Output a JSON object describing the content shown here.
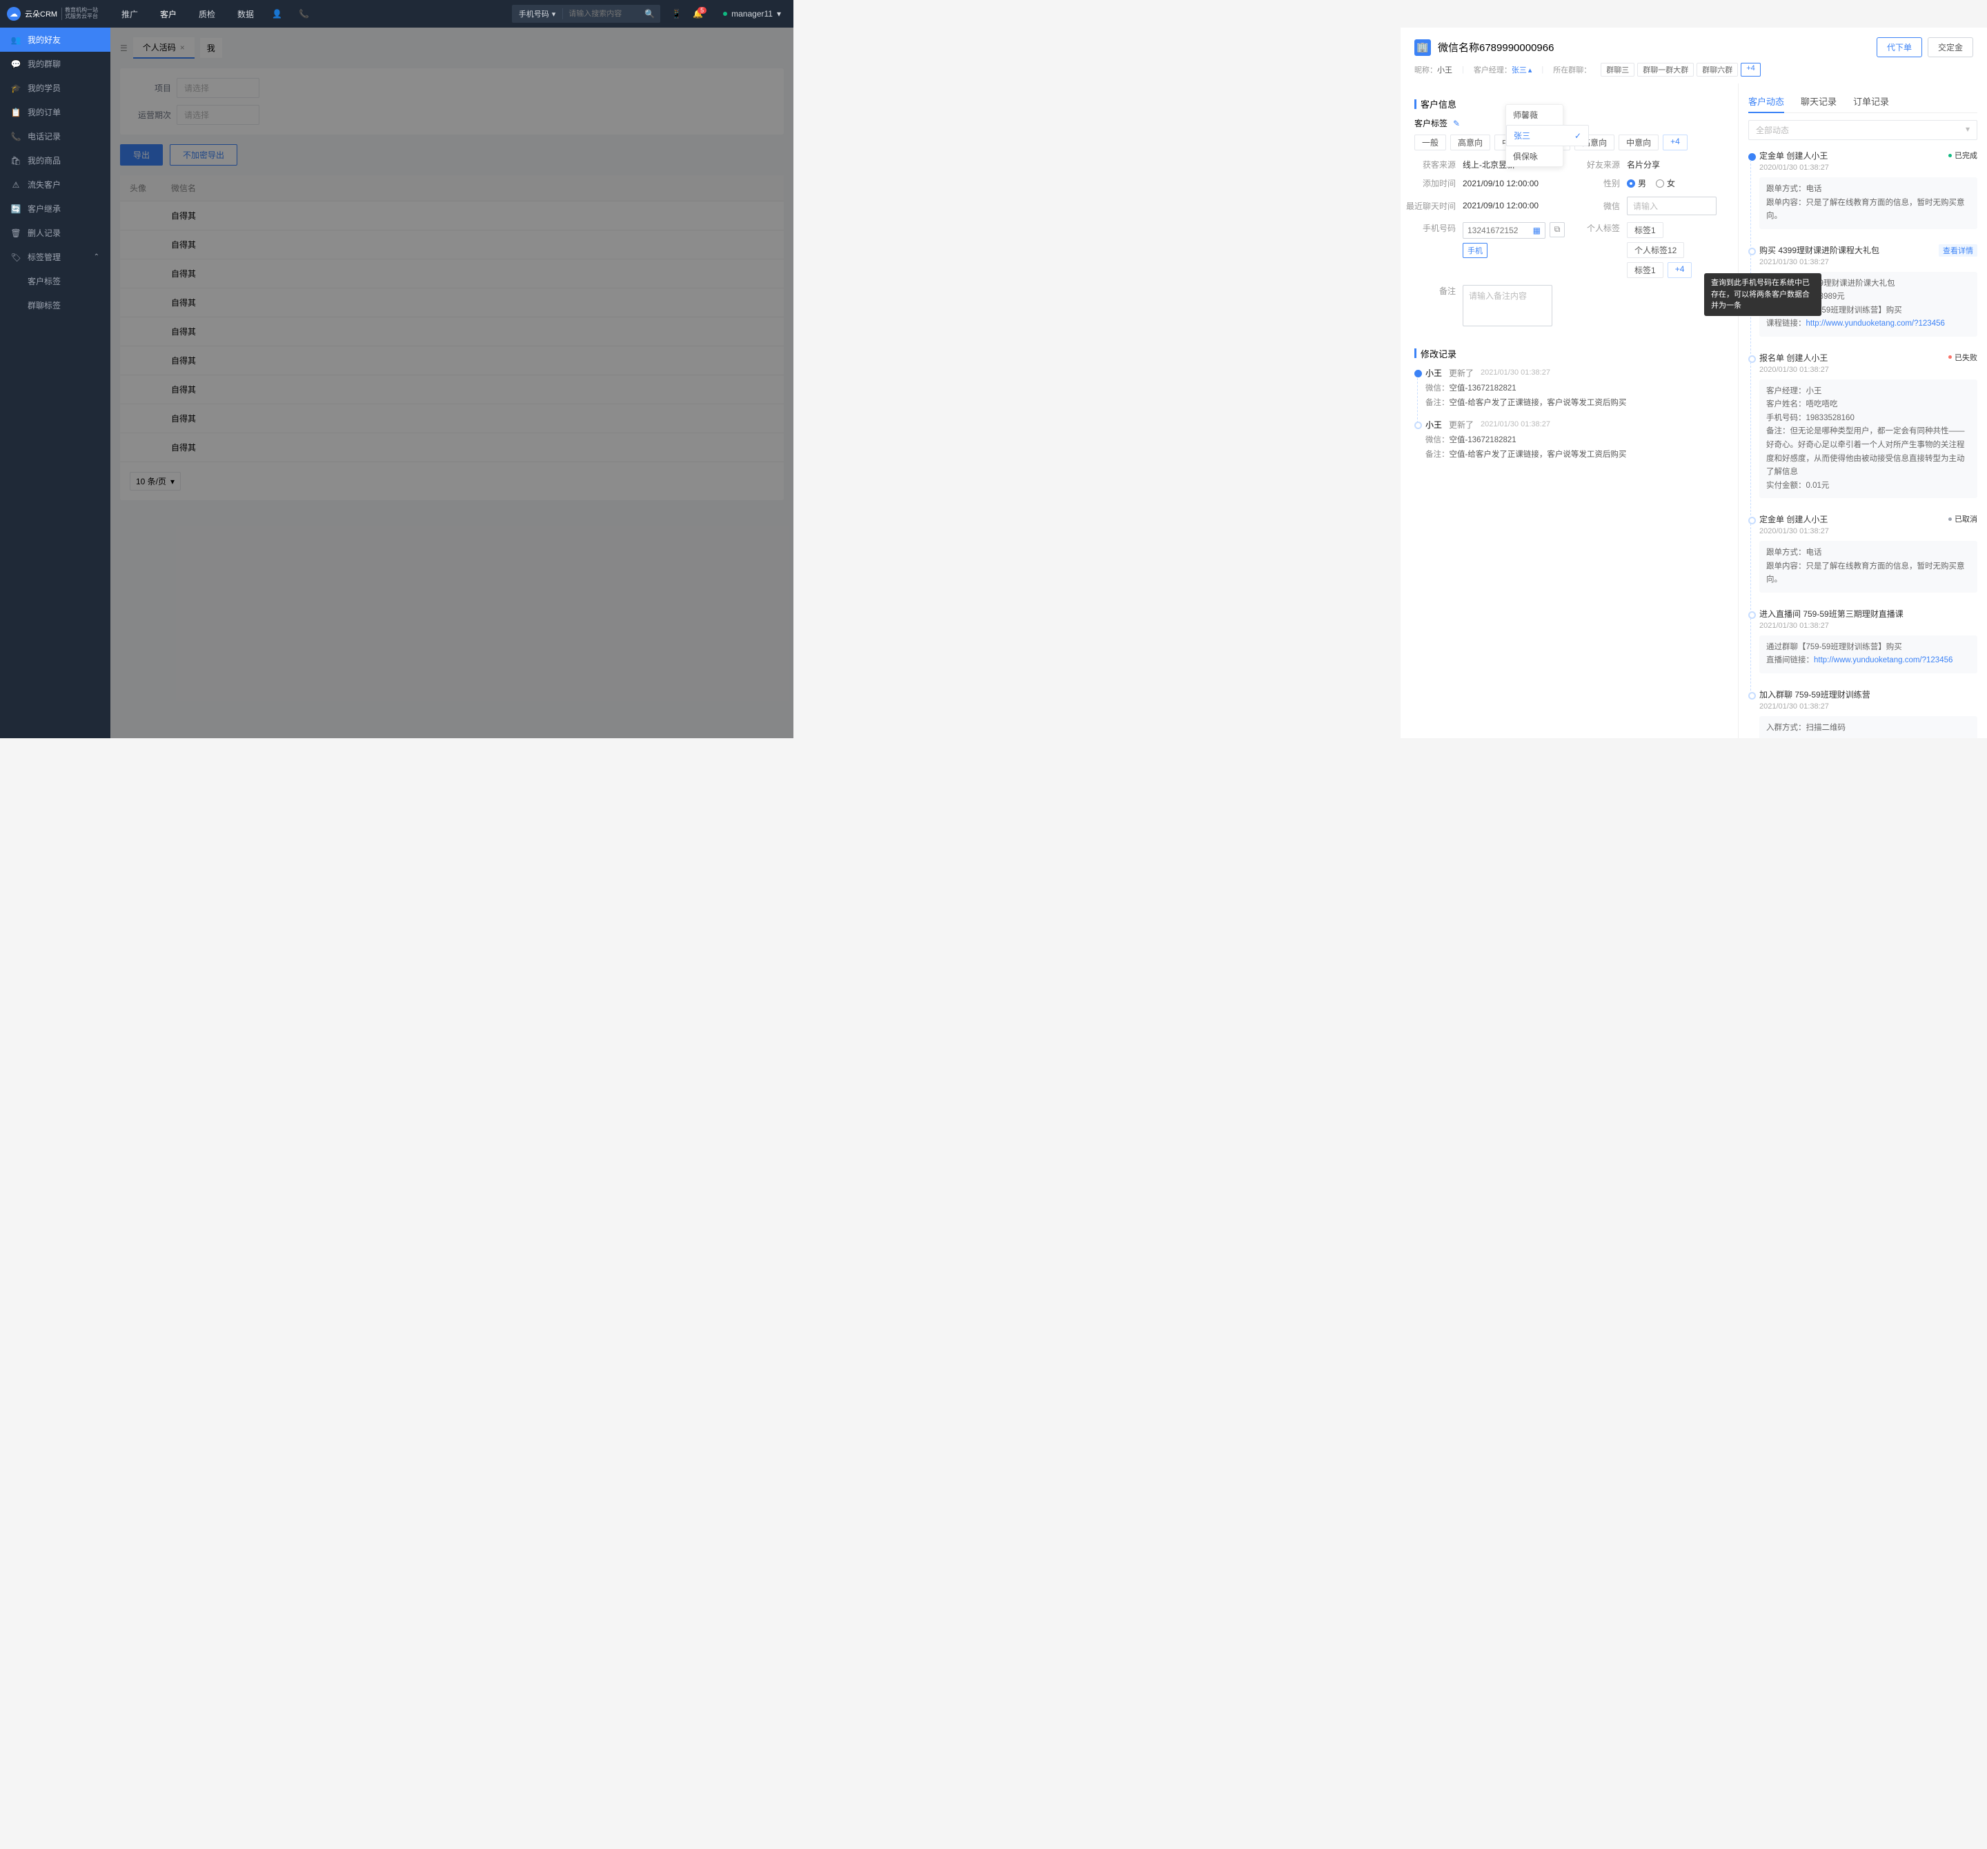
{
  "topbar": {
    "logo": "云朵CRM",
    "logo_sub": "教育机构一站\n式服务云平台",
    "nav": [
      "推广",
      "客户",
      "质检",
      "数据"
    ],
    "active_nav": 1,
    "search_type": "手机号码",
    "search_placeholder": "请输入搜索内容",
    "badge": "5",
    "user": "manager11"
  },
  "sidebar": [
    {
      "label": "我的好友",
      "active": true
    },
    {
      "label": "我的群聊"
    },
    {
      "label": "我的学员"
    },
    {
      "label": "我的订单"
    },
    {
      "label": "电话记录"
    },
    {
      "label": "我的商品"
    },
    {
      "label": "流失客户"
    },
    {
      "label": "客户继承"
    },
    {
      "label": "删人记录"
    },
    {
      "label": "标签管理",
      "expanded": true
    },
    {
      "label": "客户标签",
      "sub": true
    },
    {
      "label": "群聊标签",
      "sub": true
    }
  ],
  "bg": {
    "tab": "个人活码",
    "tab2": "我",
    "filter1": "项目",
    "filter1_ph": "请选择",
    "filter2": "运营期次",
    "filter2_ph": "请选择",
    "export": "导出",
    "noenc": "不加密导出",
    "th1": "头像",
    "th2": "微信名",
    "row_text": "自得其",
    "page_sel": "10 条/页"
  },
  "drawer": {
    "title": "微信名称6789990000966",
    "nickname_label": "昵称：",
    "nickname": "小王",
    "mgr_label": "客户经理：",
    "mgr": "张三",
    "group_label": "所在群聊：",
    "groups": [
      "群聊三",
      "群聊一群大群",
      "群聊六群"
    ],
    "group_more": "+4",
    "btn1": "代下单",
    "btn2": "交定金",
    "dropdown": [
      "师馨薇",
      "张三",
      "俱保咏"
    ],
    "dropdown_sel": 1,
    "sec_info": "客户信息",
    "tag_label": "客户标签",
    "tags1": [
      "一般",
      "高意向",
      "中意向",
      "一般",
      "高意向",
      "中意向"
    ],
    "tag_more": "+4",
    "kv": {
      "src_k": "获客来源",
      "src_v": "线上-北京昱新",
      "fsrc_k": "好友来源",
      "fsrc_v": "名片分享",
      "add_k": "添加时间",
      "add_v": "2021/09/10 12:00:00",
      "sex_k": "性别",
      "sex_m": "男",
      "sex_f": "女",
      "chat_k": "最近聊天时间",
      "chat_v": "2021/09/10 12:00:00",
      "wx_k": "微信",
      "wx_ph": "请输入",
      "phone_k": "手机号码",
      "phone_v": "13241672152",
      "phone_tag": "手机",
      "ptag_k": "个人标签",
      "ptags": [
        "标签1",
        "个人标签12",
        "标签1"
      ],
      "ptag_more": "+4",
      "remark_k": "备注",
      "remark_ph": "请输入备注内容"
    },
    "tooltip": "查询到此手机号码在系统中已存在，可以将两条客户数据合并为一条",
    "sec_mod": "修改记录",
    "mod": [
      {
        "who": "小王",
        "act": "更新了",
        "time": "2021/01/30   01:38:27",
        "lines": [
          {
            "k": "微信：",
            "v": "空值-13672182821"
          },
          {
            "k": "备注：",
            "v": "空值-给客户发了正课链接，客户说等发工资后购买"
          }
        ]
      },
      {
        "who": "小王",
        "act": "更新了",
        "time": "2021/01/30   01:38:27",
        "lines": [
          {
            "k": "微信：",
            "v": "空值-13672182821"
          },
          {
            "k": "备注：",
            "v": "空值-给客户发了正课链接，客户说等发工资后购买"
          }
        ]
      }
    ]
  },
  "right": {
    "tabs": [
      "客户动态",
      "聊天记录",
      "订单记录"
    ],
    "filter": "全部动态",
    "view_detail": "查看详情",
    "items": [
      {
        "solid": true,
        "title": "定金单  创建人小王",
        "date": "2020/01/30  01:38:27",
        "status": "已完成",
        "sdot": "green",
        "body": [
          {
            "k": "跟单方式：",
            "v": "电话"
          },
          {
            "k": "跟单内容：",
            "v": "只是了解在线教育方面的信息，暂时无购买意向。"
          }
        ]
      },
      {
        "title": "购买  4399理财课进阶课程大礼包",
        "date": "2021/01/30  01:38:27",
        "link": "查看详情",
        "body": [
          {
            "k": "课程名称：",
            "v": "4399理财课进阶课大礼包"
          },
          {
            "k": "已付款项：",
            "v": "2218989元"
          },
          {
            "k": "通过群聊",
            "v": "【759-59班理财训练营】购买"
          },
          {
            "k": "课程链接：",
            "v": "http://www.yunduoketang.com/?123456",
            "islink": true
          }
        ]
      },
      {
        "title": "报名单  创建人小王",
        "date": "2020/01/30  01:38:27",
        "status": "已失败",
        "sdot": "red",
        "body": [
          {
            "k": "客户经理：",
            "v": "小王"
          },
          {
            "k": "客户姓名：",
            "v": "唔吃唔吃"
          },
          {
            "k": "手机号码：",
            "v": "19833528160"
          },
          {
            "k": "备注：",
            "v": "但无论是哪种类型用户，都一定会有同种共性——好奇心。好奇心足以牵引着一个人对所产生事物的关注程度和好感度，从而使得他由被动接受信息直接转型为主动了解信息"
          },
          {
            "k": "实付金额：",
            "v": "0.01元"
          }
        ]
      },
      {
        "title": "定金单  创建人小王",
        "date": "2020/01/30  01:38:27",
        "status": "已取消",
        "sdot": "gray",
        "body": [
          {
            "k": "跟单方式：",
            "v": "电话"
          },
          {
            "k": "跟单内容：",
            "v": "只是了解在线教育方面的信息，暂时无购买意向。"
          }
        ]
      },
      {
        "title": "进入直播间  759-59班第三期理财直播课",
        "date": "2021/01/30  01:38:27",
        "body": [
          {
            "k": "通过群聊",
            "v": "【759-59班理财训练营】购买"
          },
          {
            "k": "直播间链接：",
            "v": "http://www.yunduoketang.com/?123456",
            "islink": true
          }
        ]
      },
      {
        "title": "加入群聊  759-59班理财训练营",
        "date": "2021/01/30  01:38:27",
        "body": [
          {
            "k": "入群方式：",
            "v": "扫描二维码"
          }
        ]
      }
    ]
  }
}
